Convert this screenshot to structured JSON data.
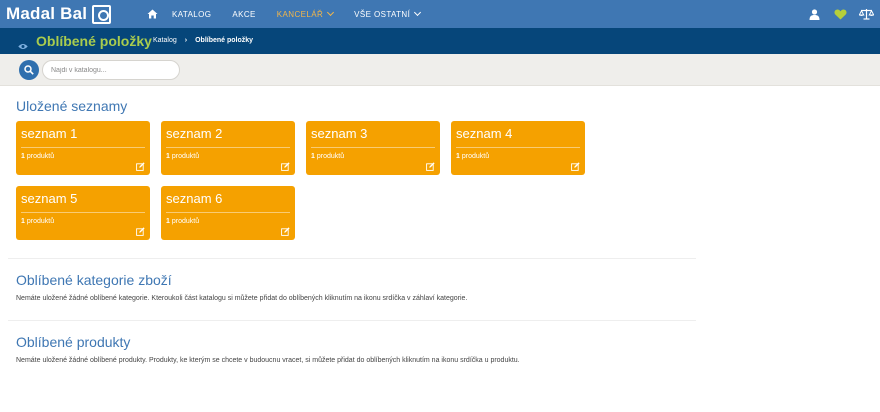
{
  "header": {
    "logo_text": "Madal Bal",
    "nav": [
      {
        "label": "KATALOG",
        "active": false,
        "dropdown": false
      },
      {
        "label": "AKCE",
        "active": false,
        "dropdown": false
      },
      {
        "label": "KANCELÁŘ",
        "active": true,
        "dropdown": true
      },
      {
        "label": "VŠE OSTATNÍ",
        "active": false,
        "dropdown": true
      }
    ],
    "icons": [
      "home-icon",
      "user-icon",
      "heart-icon",
      "scales-icon"
    ]
  },
  "titlebar": {
    "title": "Oblíbené položky",
    "breadcrumb": [
      "Katalog",
      "Oblíbené položky"
    ]
  },
  "search": {
    "placeholder": "Najdi v katalogu..."
  },
  "saved_lists": {
    "title": "Uložené seznamy",
    "items": [
      {
        "name": "seznam 1",
        "count": "1",
        "unit": "produktů"
      },
      {
        "name": "seznam 2",
        "count": "1",
        "unit": "produktů"
      },
      {
        "name": "seznam 3",
        "count": "1",
        "unit": "produktů"
      },
      {
        "name": "seznam 4",
        "count": "1",
        "unit": "produktů"
      },
      {
        "name": "seznam 5",
        "count": "1",
        "unit": "produktů"
      },
      {
        "name": "seznam 6",
        "count": "1",
        "unit": "produktů"
      }
    ]
  },
  "categories": {
    "title": "Oblíbené kategorie zboží",
    "text": "Nemáte uložené žádné oblíbené kategorie. Kteroukoli část katalogu si můžete přidat do oblíbených kliknutím na ikonu srdíčka v záhlaví kategorie."
  },
  "products": {
    "title": "Oblíbené produkty",
    "text": "Nemáte uložené žádné oblíbené produkty. Produkty, ke kterým se chcete v budoucnu vracet, si můžete přidat do oblíbených kliknutím na ikonu srdíčka u produktu."
  },
  "colors": {
    "nav_bg": "#3f77b3",
    "titlebar_bg": "#06467a",
    "title_green": "#a9cc4e",
    "card_orange": "#f5a100",
    "heading_blue": "#3f77b3",
    "active_nav": "#f3b64a"
  }
}
